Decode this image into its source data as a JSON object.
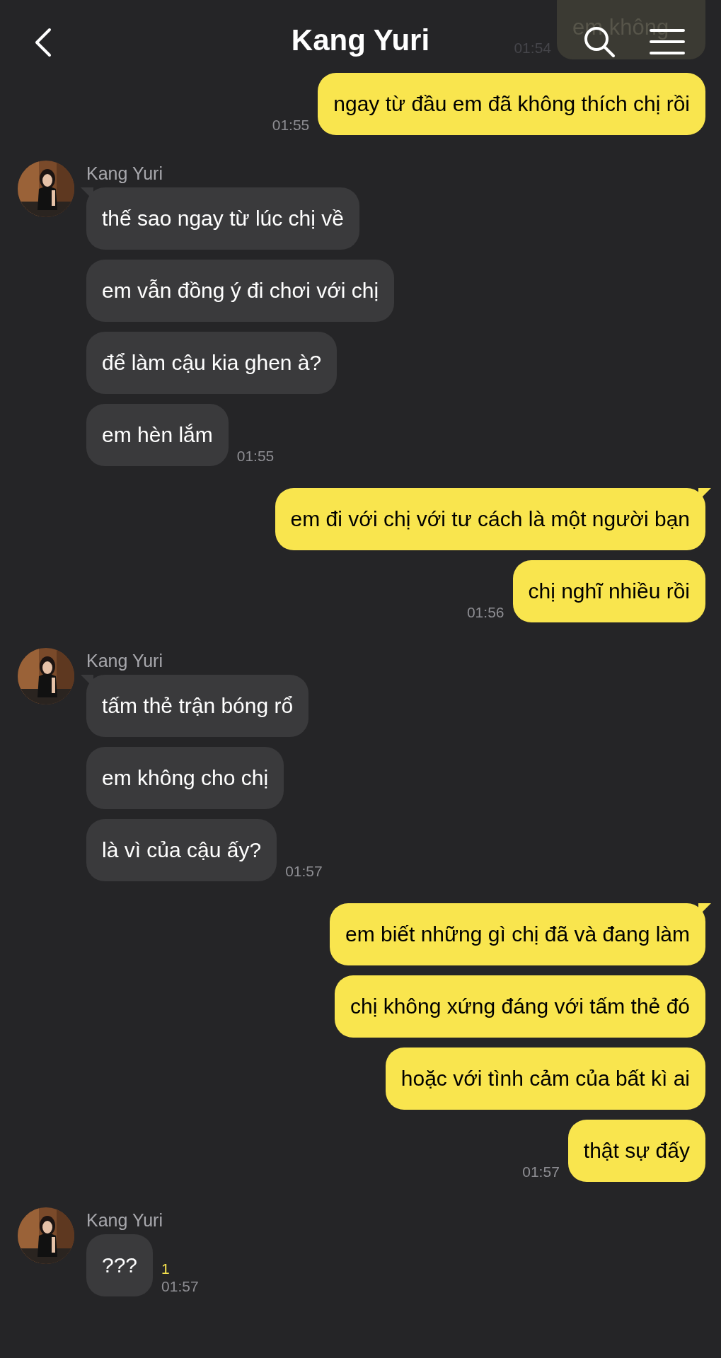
{
  "header": {
    "title": "Kang Yuri"
  },
  "faded_message": {
    "text": "em không",
    "time": "01:54"
  },
  "groups": [
    {
      "kind": "sent",
      "messages": [
        "ngay từ đầu em đã không thích chị rồi"
      ],
      "time": "01:55"
    },
    {
      "kind": "received",
      "name": "Kang Yuri",
      "messages": [
        "thế sao ngay từ lúc chị về",
        "em vẫn đồng ý đi chơi với chị",
        "để làm cậu kia ghen à?",
        "em hèn lắm"
      ],
      "time": "01:55"
    },
    {
      "kind": "sent",
      "messages": [
        "em đi với chị với tư cách là một người bạn",
        "chị nghĩ nhiều rồi"
      ],
      "time": "01:56"
    },
    {
      "kind": "received",
      "name": "Kang Yuri",
      "messages": [
        "tấm thẻ trận bóng rổ",
        "em không cho chị",
        "là vì của cậu ấy?"
      ],
      "time": "01:57"
    },
    {
      "kind": "sent",
      "messages": [
        "em biết những gì chị đã và đang làm",
        "chị không xứng đáng với tấm thẻ đó",
        "hoặc với tình cảm của bất kì ai",
        "thật sự đấy"
      ],
      "time": "01:57"
    },
    {
      "kind": "received",
      "name": "Kang Yuri",
      "messages": [
        "???"
      ],
      "unread": "1",
      "time": "01:57"
    }
  ]
}
